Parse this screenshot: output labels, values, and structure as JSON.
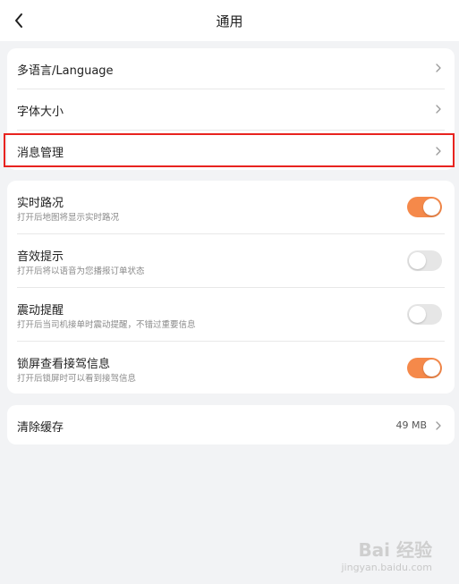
{
  "header": {
    "title": "通用",
    "back_icon": "chevron-left-icon"
  },
  "group1": {
    "items": [
      {
        "label": "多语言/Language"
      },
      {
        "label": "字体大小"
      },
      {
        "label": "消息管理"
      }
    ]
  },
  "group2": {
    "items": [
      {
        "label": "实时路况",
        "desc": "打开后地图将显示实时路况",
        "enabled": true
      },
      {
        "label": "音效提示",
        "desc": "打开后将以语音为您播报订单状态",
        "enabled": false
      },
      {
        "label": "震动提醒",
        "desc": "打开后当司机接单时震动提醒，不错过重要信息",
        "enabled": false
      },
      {
        "label": "锁屏查看接驾信息",
        "desc": "打开后锁屏时可以看到接驾信息",
        "enabled": true
      }
    ]
  },
  "cache": {
    "label": "清除缓存",
    "value": "49 MB"
  },
  "colors": {
    "accent": "#f5894a",
    "highlight": "#e8231f",
    "background": "#f2f3f5"
  },
  "watermark": {
    "main": "Bai 经验",
    "sub": "jingyan.baidu.com"
  }
}
